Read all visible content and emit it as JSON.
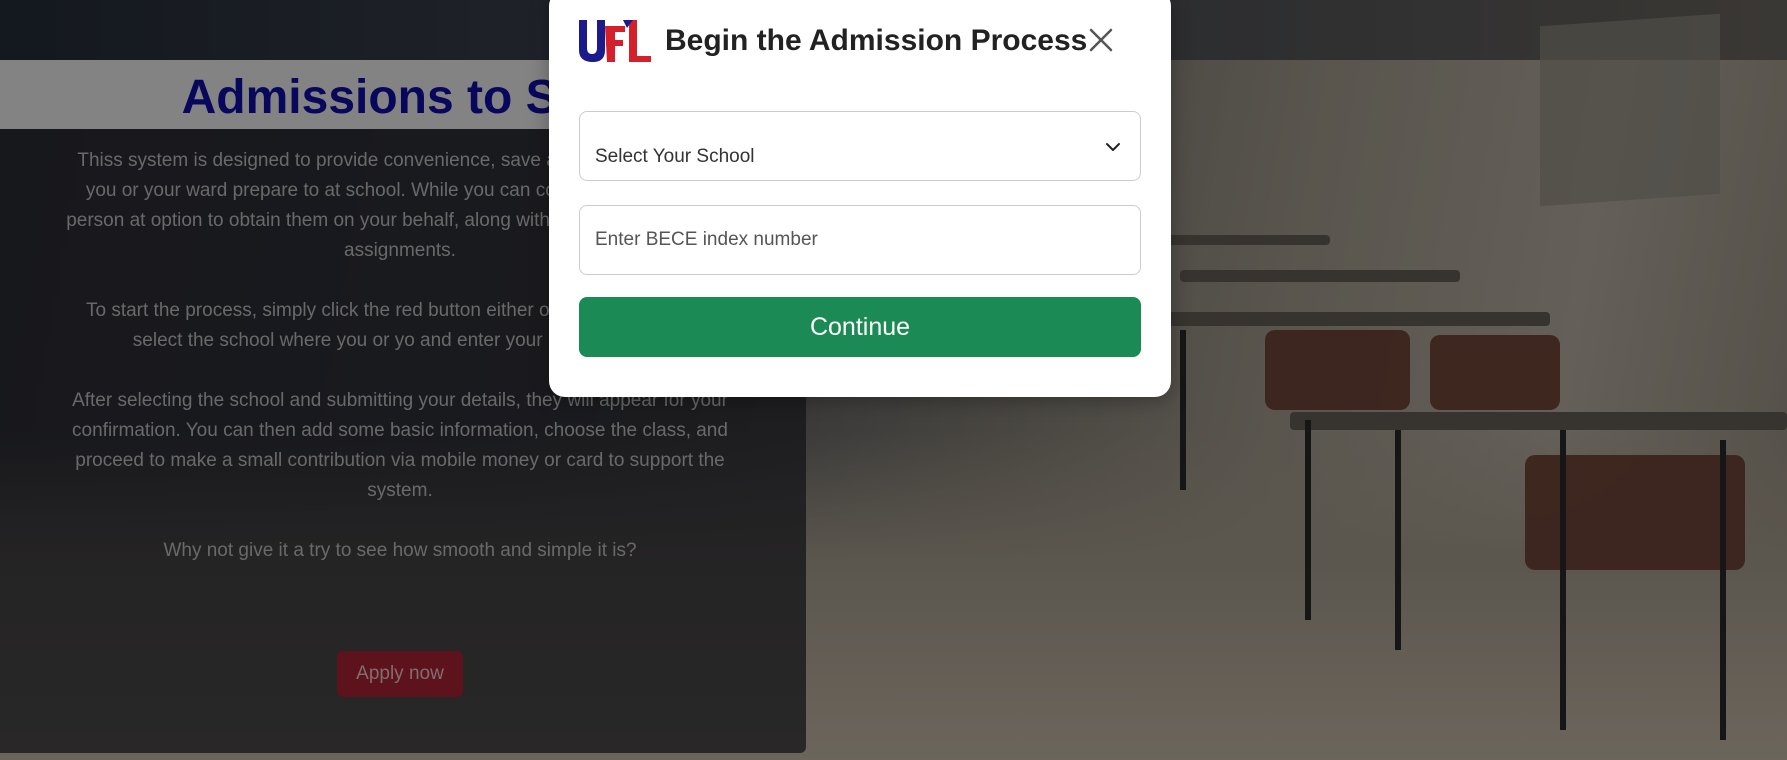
{
  "page": {
    "title": "Admissions to SHS",
    "intro_paragraphs": [
      "Thiss system is designed to provide convenience, save and ensure safety as you or your ward prepare to at school. While you can collect these forms in person at option to obtain them on your behalf, along with addi class and house assignments.",
      "To start the process, simply click the red button either open a popup. Then, select the school where you or yo and enter your index number.",
      "After selecting the school and submitting your details, they will appear for your confirmation. You can then add some basic information, choose the class, and proceed to make a small contribution via mobile money or card to support the system.",
      "Why not give it a try to see how smooth and simple it is?"
    ],
    "apply_label": "Apply now"
  },
  "modal": {
    "logo_text": "UFL",
    "title": "Begin the Admission Process",
    "school_select": {
      "selected": "Select Your School"
    },
    "index_input": {
      "placeholder": "Enter BECE index number"
    },
    "continue_label": "Continue"
  },
  "colors": {
    "title_blue": "#0d0b8e",
    "apply_red": "#8e1e2b",
    "continue_green": "#1c8a55",
    "logo_blue": "#1a1a8c",
    "logo_red": "#d3202a"
  }
}
